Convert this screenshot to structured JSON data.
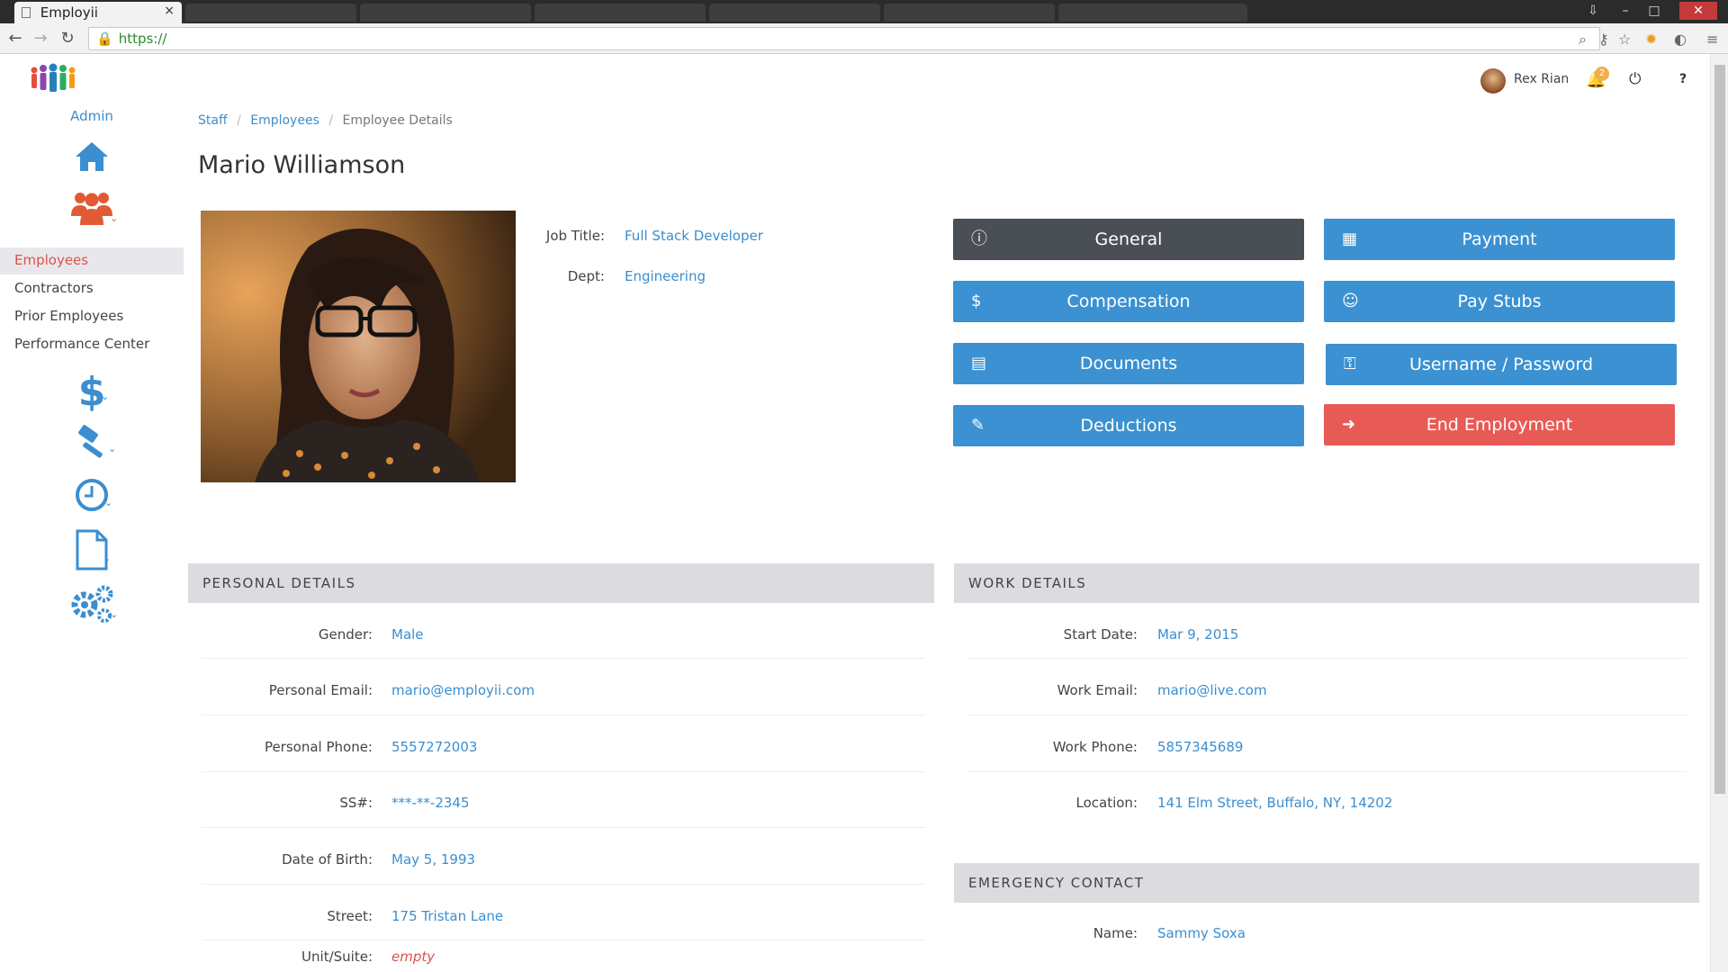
{
  "browser": {
    "tab_title": "Employii",
    "tab_close": "×",
    "address": "https://",
    "window_min": "–",
    "window_max": "□",
    "window_close": "✕"
  },
  "app": {
    "sidebar": {
      "admin_label": "Admin",
      "items": [
        {
          "label": "Employees",
          "active": true
        },
        {
          "label": "Contractors"
        },
        {
          "label": "Prior Employees"
        },
        {
          "label": "Performance Center"
        }
      ],
      "icons": [
        "home-icon",
        "people-icon",
        "dollar-icon",
        "gavel-icon",
        "clock-icon",
        "document-icon",
        "gears-icon"
      ]
    },
    "topbar": {
      "username": "Rex Rian",
      "notification_count": "2",
      "help": "?"
    },
    "breadcrumb": {
      "staff": "Staff",
      "employees": "Employees",
      "current": "Employee Details",
      "separator": "/"
    },
    "employee": {
      "name": "Mario Williamson",
      "job_title_label": "Job Title:",
      "job_title": "Full Stack Developer",
      "dept_label": "Dept:",
      "dept": "Engineering"
    },
    "actions": {
      "general": "General",
      "payment": "Payment",
      "compensation": "Compensation",
      "pay_stubs": "Pay Stubs",
      "documents": "Documents",
      "username_password": "Username / Password",
      "deductions": "Deductions",
      "end_employment": "End Employment"
    },
    "personal": {
      "heading": "PERSONAL DETAILS",
      "rows": [
        {
          "label": "Gender:",
          "value": "Male"
        },
        {
          "label": "Personal Email:",
          "value": "mario@employii.com"
        },
        {
          "label": "Personal Phone:",
          "value": "5557272003"
        },
        {
          "label": "SS#:",
          "value": "***-**-2345"
        },
        {
          "label": "Date of Birth:",
          "value": "May 5, 1993"
        },
        {
          "label": "Street:",
          "value": "175 Tristan Lane"
        },
        {
          "label": "Unit/Suite:",
          "value": "empty"
        }
      ]
    },
    "work": {
      "heading": "WORK DETAILS",
      "rows": [
        {
          "label": "Start Date:",
          "value": "Mar 9, 2015"
        },
        {
          "label": "Work Email:",
          "value": "mario@live.com"
        },
        {
          "label": "Work Phone:",
          "value": "5857345689"
        },
        {
          "label": "Location:",
          "value": "141 Elm Street, Buffalo, NY, 14202"
        }
      ]
    },
    "emergency": {
      "heading": "EMERGENCY CONTACT",
      "rows": [
        {
          "label": "Name:",
          "value": "Sammy Soxa"
        }
      ]
    },
    "colors": {
      "primary": "#3b91d1",
      "dark": "#4a4e55",
      "danger": "#e85a55",
      "link": "#3b8ed0",
      "active_nav": "#d9534f"
    }
  }
}
